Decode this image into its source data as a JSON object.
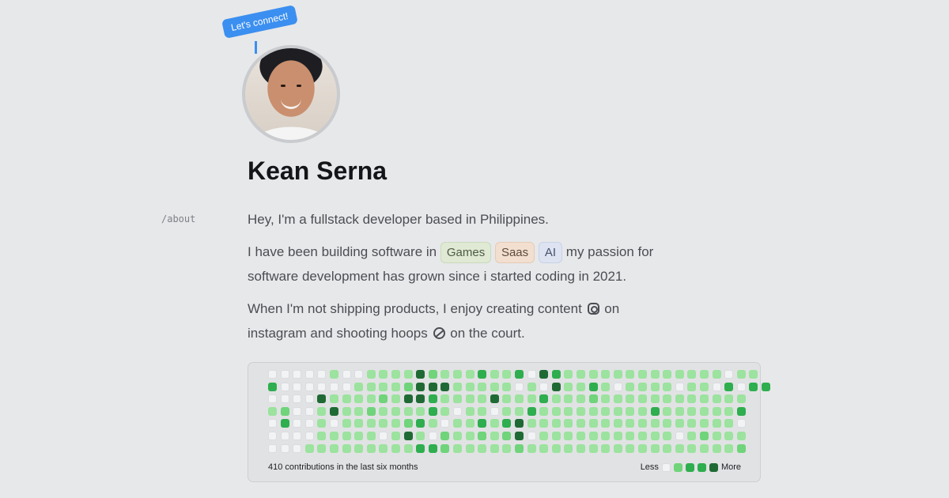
{
  "badge": "Let's connect!",
  "name": "Kean Serna",
  "side_label": "/about",
  "bio": {
    "line1": "Hey, I'm a fullstack developer based in Philippines.",
    "line2_pre": "I have been building software in",
    "tags": [
      "Games",
      "Saas",
      "AI"
    ],
    "line2_post": "my passion for",
    "line3": "software development has grown since i started coding in 2021.",
    "line4_pre": "When I'm not shipping products, I enjoy creating content",
    "line4_icon": "instagram-icon",
    "line4_post": "on",
    "line5_pre": "instagram and shooting hoops",
    "line5_icon": "basketball-icon",
    "line5_post": "on the court."
  },
  "contributions": {
    "summary": "410 contributions in the last six months",
    "legend_less": "Less",
    "legend_more": "More",
    "colors": [
      "#f2f3f5",
      "#9be39e",
      "#6fd47a",
      "#2eae4e",
      "#1f6a34"
    ],
    "levels": [
      [
        0,
        0,
        0,
        0,
        0,
        1,
        0,
        0,
        1,
        1,
        1,
        1,
        4,
        2,
        1,
        1,
        1,
        3,
        1,
        1,
        3,
        0,
        4,
        3,
        1,
        1,
        1,
        1,
        1,
        1,
        1,
        1,
        1,
        1,
        1,
        1,
        1,
        0,
        1,
        1
      ],
      [
        3,
        0,
        0,
        0,
        0,
        0,
        0,
        1,
        1,
        1,
        1,
        2,
        4,
        4,
        4,
        1,
        1,
        1,
        1,
        1,
        0,
        1,
        0,
        4,
        1,
        1,
        3,
        1,
        0,
        1,
        1,
        1,
        1,
        0,
        1,
        1,
        0,
        3,
        0,
        3,
        3
      ],
      [
        0,
        0,
        0,
        0,
        4,
        1,
        1,
        1,
        1,
        2,
        1,
        4,
        4,
        3,
        1,
        1,
        1,
        1,
        4,
        1,
        1,
        1,
        3,
        1,
        1,
        1,
        2,
        1,
        1,
        1,
        1,
        1,
        1,
        1,
        1,
        1,
        1,
        1,
        1
      ],
      [
        1,
        2,
        0,
        0,
        1,
        4,
        1,
        1,
        2,
        1,
        1,
        1,
        1,
        3,
        1,
        0,
        1,
        1,
        0,
        1,
        1,
        3,
        1,
        1,
        1,
        1,
        1,
        1,
        1,
        1,
        1,
        3,
        1,
        1,
        1,
        1,
        1,
        1,
        3
      ],
      [
        0,
        3,
        0,
        0,
        1,
        0,
        1,
        1,
        1,
        1,
        1,
        2,
        3,
        1,
        0,
        1,
        1,
        3,
        1,
        3,
        4,
        1,
        1,
        1,
        1,
        1,
        1,
        1,
        1,
        1,
        1,
        1,
        1,
        1,
        1,
        1,
        1,
        1,
        0
      ],
      [
        0,
        0,
        0,
        0,
        1,
        1,
        1,
        1,
        1,
        0,
        1,
        4,
        1,
        0,
        2,
        1,
        1,
        2,
        1,
        2,
        4,
        0,
        1,
        1,
        1,
        1,
        1,
        1,
        1,
        1,
        1,
        1,
        1,
        0,
        1,
        2,
        1,
        1,
        1
      ],
      [
        0,
        0,
        0,
        1,
        1,
        1,
        1,
        1,
        1,
        1,
        1,
        1,
        3,
        3,
        2,
        1,
        1,
        1,
        1,
        1,
        2,
        1,
        1,
        1,
        1,
        1,
        1,
        1,
        1,
        1,
        1,
        1,
        1,
        1,
        1,
        1,
        1,
        1,
        2
      ]
    ]
  }
}
